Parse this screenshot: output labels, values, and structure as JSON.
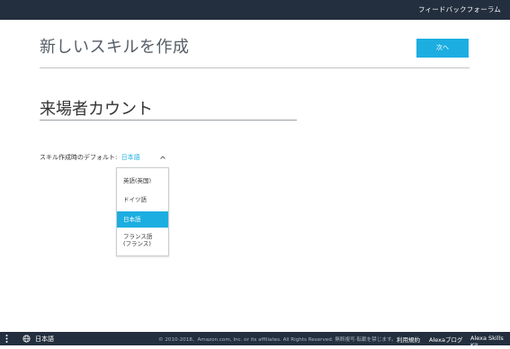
{
  "header": {
    "forum_link": "フィードバックフォーラム"
  },
  "page": {
    "title": "新しいスキルを作成",
    "next_button": "次へ",
    "skill_name_value": "来場者カウント"
  },
  "language_select": {
    "label": "スキル作成時のデフォルト:",
    "selected": "日本語",
    "options": [
      "英語(英国)",
      "ドイツ語",
      "日本語",
      "フランス語 (フランス)"
    ],
    "option_last_line1": "フランス語",
    "option_last_line2": "(フランス)"
  },
  "footer": {
    "language": "日本語",
    "copyright": "© 2010-2018、Amazon.com, Inc. or its affiliates. All Rights Reserved. 無断複写·転載を禁じます。",
    "terms": "利用規約",
    "blog": "Alexaブログ",
    "kit": "Alexa Skills Kit"
  },
  "colors": {
    "topbar": "#232f3e",
    "accent": "#1caee0"
  },
  "icons": {
    "chevron": "chevron-up-icon",
    "globe": "globe-icon",
    "menu": "vertical-dots-icon"
  }
}
